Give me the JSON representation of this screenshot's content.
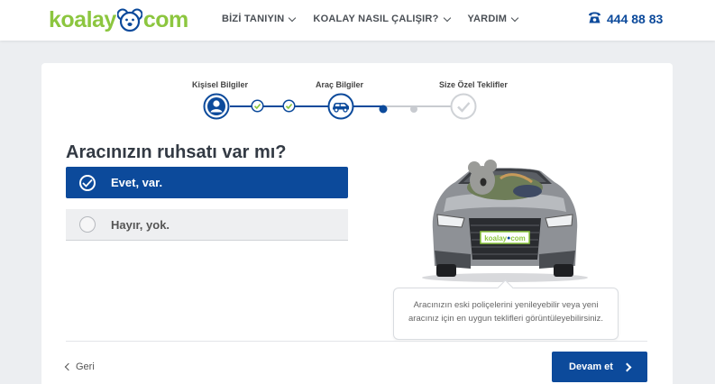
{
  "header": {
    "logo_left": "koalay",
    "logo_right": "com",
    "nav": [
      {
        "label": "BİZİ TANIYIN"
      },
      {
        "label": "KOALAY NASIL ÇALIŞIR?"
      },
      {
        "label": "YARDIM"
      }
    ],
    "phone": "444 88 83"
  },
  "stepper": {
    "steps": [
      "Kişisel Bilgiler",
      "Araç Bilgiler",
      "Size Özel Teklifler"
    ]
  },
  "question": "Aracınızın ruhsatı var mı?",
  "options": [
    {
      "label": "Evet, var.",
      "selected": true
    },
    {
      "label": "Hayır, yok.",
      "selected": false
    }
  ],
  "car": {
    "plate_left": "koalay",
    "plate_right": "com"
  },
  "tooltip": {
    "line1": "Aracınızın eski poliçelerini yenileyebilir veya yeni",
    "line2": "aracınız için en uygun teklifleri görüntüleyebilirsiniz."
  },
  "footer": {
    "back_label": "Geri",
    "next_label": "Devam et"
  },
  "colors": {
    "brand_blue": "#0c4a9b",
    "brand_green": "#8cc63f",
    "check_green": "#8cc63f"
  }
}
